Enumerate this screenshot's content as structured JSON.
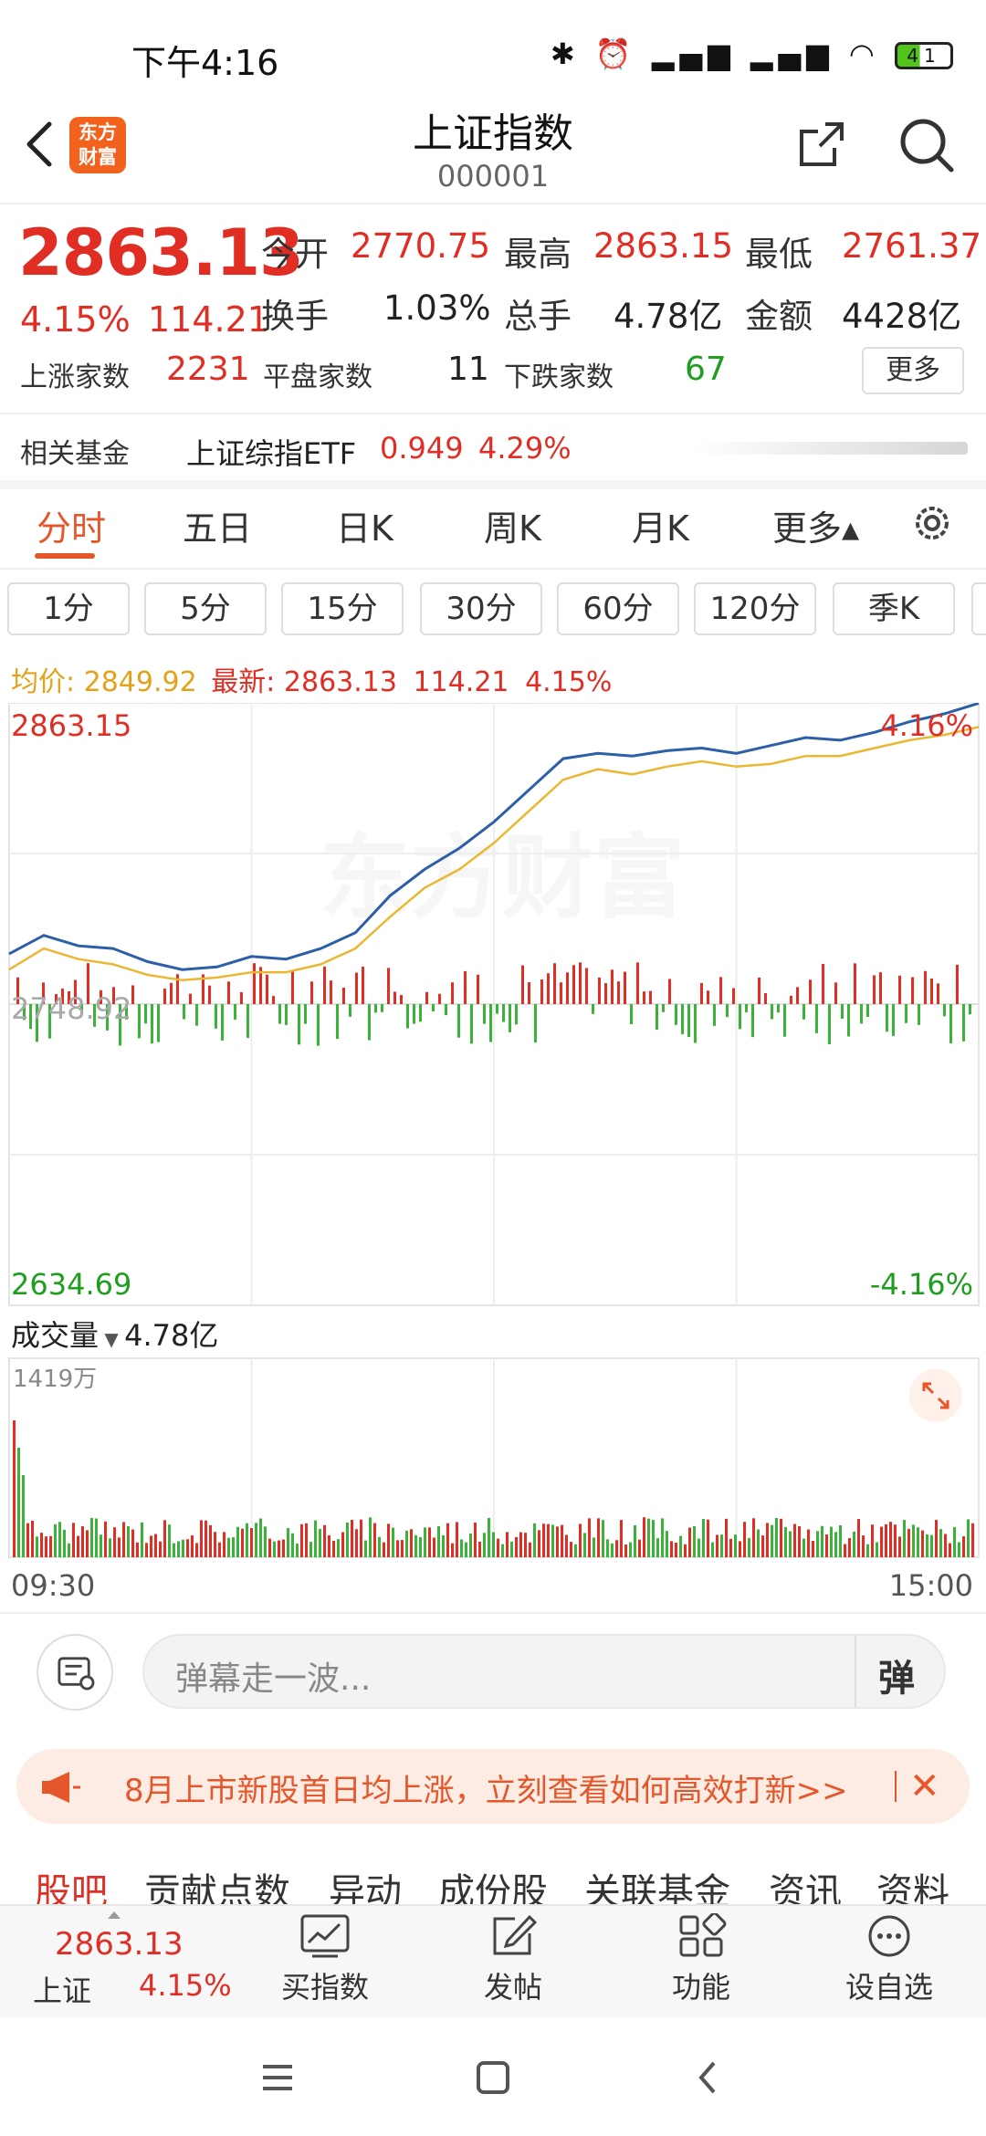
{
  "status_bar": {
    "time": "下午4:16",
    "battery": "41"
  },
  "header": {
    "title": "上证指数",
    "code": "000001",
    "logo_line1": "东方",
    "logo_line2": "财富"
  },
  "quote": {
    "price": "2863.13",
    "change_pct": "4.15%",
    "change_amt": "114.21",
    "open_label": "今开",
    "open": "2770.75",
    "high_label": "最高",
    "high": "2863.15",
    "low_label": "最低",
    "low": "2761.37",
    "turnover_label": "换手",
    "turnover": "1.03%",
    "volume_label": "总手",
    "volume": "4.78亿",
    "amount_label": "金额",
    "amount": "4428亿",
    "up_label": "上涨家数",
    "up": "2231",
    "flat_label": "平盘家数",
    "flat": "11",
    "down_label": "下跌家数",
    "down": "67",
    "more_label": "更多"
  },
  "related_fund": {
    "label": "相关基金",
    "name": "上证综指ETF",
    "price": "0.949",
    "pct": "4.29%"
  },
  "chart_tabs": [
    {
      "label": "分时",
      "active": true
    },
    {
      "label": "五日"
    },
    {
      "label": "日K"
    },
    {
      "label": "周K"
    },
    {
      "label": "月K"
    },
    {
      "label": "更多▴"
    }
  ],
  "periods": [
    "1分",
    "5分",
    "15分",
    "30分",
    "60分",
    "120分",
    "季K"
  ],
  "chart_info": {
    "avg_label": "均价:",
    "avg": "2849.92",
    "latest_label": "最新:",
    "latest": "2863.13",
    "latest_chg": "114.21",
    "latest_pct": "4.15%"
  },
  "chart_data": {
    "type": "line",
    "y_high": "2863.15",
    "y_high_pct": "4.16%",
    "y_mid": "2748.92",
    "y_low": "2634.69",
    "y_low_pct": "-4.16%",
    "ylim": [
      2634.69,
      2863.15
    ],
    "x_start": "09:30",
    "x_end": "15:00",
    "series": [
      {
        "values": [
          2768,
          2775,
          2771,
          2770,
          2765,
          2762,
          2763,
          2767,
          2766,
          2770,
          2776,
          2790,
          2800,
          2808,
          2818,
          2830,
          2842,
          2844,
          2843,
          2845,
          2846,
          2844,
          2847,
          2850,
          2849,
          2852,
          2856,
          2859,
          2863
        ]
      },
      {
        "values": [
          2762,
          2770,
          2766,
          2764,
          2760,
          2758,
          2759,
          2761,
          2761,
          2764,
          2770,
          2782,
          2793,
          2800,
          2810,
          2822,
          2834,
          2838,
          2836,
          2839,
          2841,
          2839,
          2840,
          2843,
          2843,
          2846,
          2849,
          2851,
          2854
        ]
      }
    ],
    "volume_label": "成交量",
    "volume_total": "4.78亿",
    "volume_max": "1419万"
  },
  "danmaku": {
    "placeholder": "弹幕走一波...",
    "toggle": "弹"
  },
  "banner": {
    "text": "8月上市新股首日均上涨，立刻查看如何高效打新>>"
  },
  "section_tabs": [
    "股吧",
    "贡献点数",
    "异动",
    "成份股",
    "关联基金",
    "资讯",
    "资料"
  ],
  "bottom_bar": {
    "price": "2863.13",
    "name": "上证",
    "pct": "4.15%",
    "items": [
      "买指数",
      "发帖",
      "功能",
      "设自选"
    ]
  },
  "watermark": "东方财富"
}
